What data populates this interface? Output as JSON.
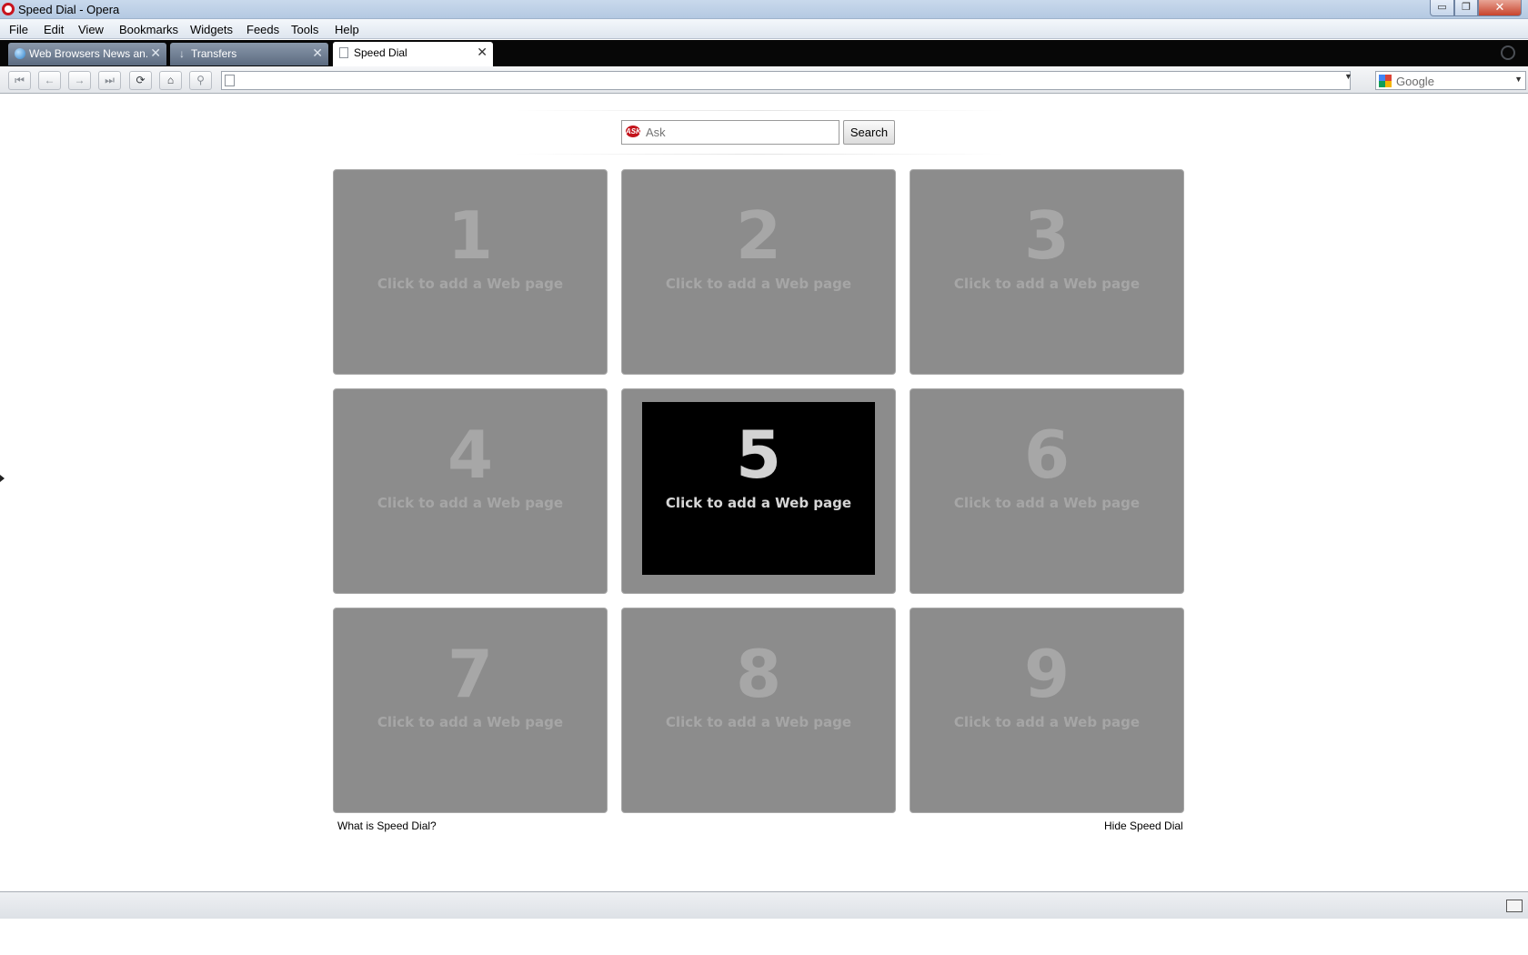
{
  "window": {
    "title": "Speed Dial - Opera",
    "min_glyph": "▭",
    "max_glyph": "❐",
    "close_glyph": "✕"
  },
  "menu": {
    "items": [
      "File",
      "Edit",
      "View",
      "Bookmarks",
      "Widgets",
      "Feeds",
      "Tools",
      "Help"
    ]
  },
  "tabs": [
    {
      "label": "Web Browsers News an...",
      "icon": "globe-icon",
      "close": "✕",
      "active": false
    },
    {
      "label": "Transfers",
      "icon": "download-icon",
      "close": "✕",
      "active": false
    },
    {
      "label": "Speed Dial",
      "icon": "page-icon",
      "close": "✕",
      "active": true
    }
  ],
  "toolbar": {
    "rewind_glyph": "⏮",
    "back_glyph": "←",
    "forward_glyph": "→",
    "fastforward_glyph": "⏭",
    "reload_glyph": "⟳",
    "home_glyph": "⌂",
    "wand_glyph": "⚲",
    "address_value": "",
    "address_dropdown_glyph": "▼",
    "search_engine": "Google",
    "search_engine_dropdown_glyph": "▼"
  },
  "speed_dial": {
    "search_placeholder": "Ask",
    "search_value": "",
    "search_button": "Search",
    "ask_logo_text": "ASK",
    "dials": [
      {
        "number": "1",
        "text": "Click to add a Web page",
        "hover": false
      },
      {
        "number": "2",
        "text": "Click to add a Web page",
        "hover": false
      },
      {
        "number": "3",
        "text": "Click to add a Web page",
        "hover": false
      },
      {
        "number": "4",
        "text": "Click to add a Web page",
        "hover": false
      },
      {
        "number": "5",
        "text": "Click to add a Web page",
        "hover": true
      },
      {
        "number": "6",
        "text": "Click to add a Web page",
        "hover": false
      },
      {
        "number": "7",
        "text": "Click to add a Web page",
        "hover": false
      },
      {
        "number": "8",
        "text": "Click to add a Web page",
        "hover": false
      },
      {
        "number": "9",
        "text": "Click to add a Web page",
        "hover": false
      }
    ],
    "what_is_link": "What is Speed Dial?",
    "hide_link": "Hide Speed Dial"
  },
  "colors": {
    "dial_background": "#8c8c8c",
    "dial_hover": "#000000",
    "tabbar": "#070707",
    "close_button": "#c8432c"
  }
}
